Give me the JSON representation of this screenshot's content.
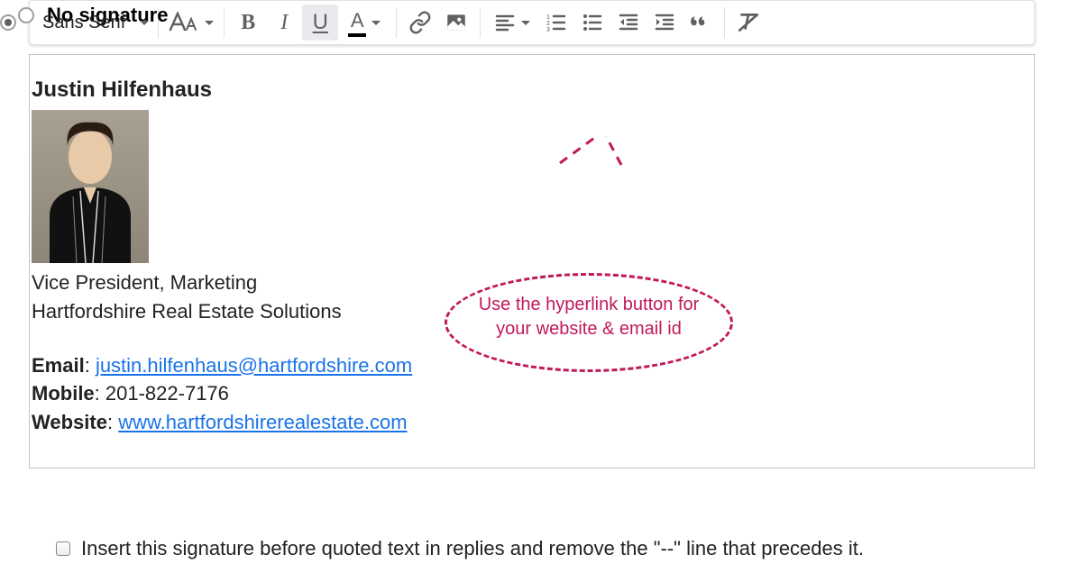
{
  "no_signature_label": "No signature",
  "toolbar": {
    "font_family": "Sans Serif",
    "underline_selected": true
  },
  "signature": {
    "name": "Justin Hilfenhaus",
    "title": "Vice President, Marketing",
    "company": "Hartfordshire Real Estate Solutions",
    "email_label": "Email",
    "email_sep": ": ",
    "email_value": "justin.hilfenhaus@hartfordshire.com",
    "mobile_label": "Mobile",
    "mobile_sep": ": 201-822-7176",
    "website_label": "Website",
    "website_sep": ": ",
    "website_value": "www.hartfordshirerealestate.com"
  },
  "annotation": {
    "text": "Use the hyperlink button for your website & email id"
  },
  "insert_checkbox_label": "Insert this signature before quoted text in replies and remove the \"--\" line that precedes it."
}
